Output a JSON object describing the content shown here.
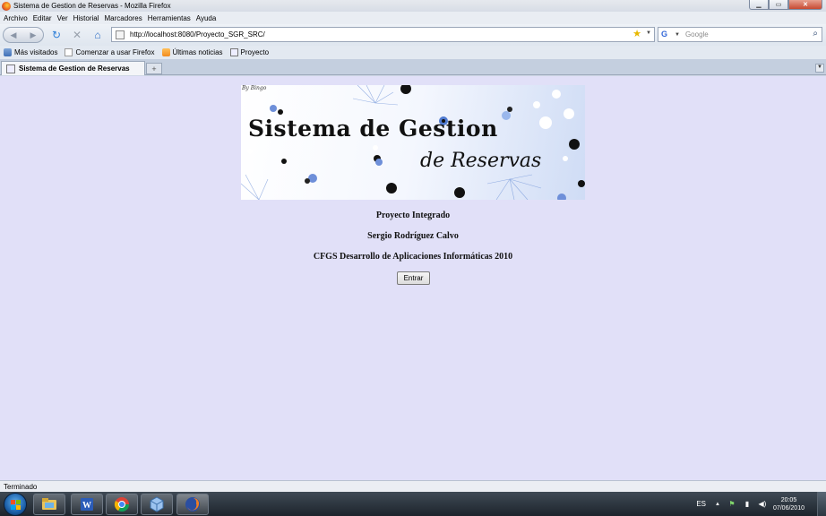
{
  "window": {
    "title": "Sistema de Gestion de Reservas - Mozilla Firefox"
  },
  "menu": {
    "items": [
      "Archivo",
      "Editar",
      "Ver",
      "Historial",
      "Marcadores",
      "Herramientas",
      "Ayuda"
    ]
  },
  "navbar": {
    "url": "http://localhost:8080/Proyecto_SGR_SRC/",
    "search_placeholder": "Google"
  },
  "bookmarks": {
    "items": [
      "Más visitados",
      "Comenzar a usar Firefox",
      "Últimas noticias",
      "Proyecto"
    ]
  },
  "tabs": {
    "active_label": "Sistema de Gestion de Reservas",
    "new_tab_label": "+"
  },
  "page": {
    "banner_signature": "By Bingo",
    "banner_title_line1": "Sistema de Gestion",
    "banner_title_line2": "de Reservas",
    "line1": "Proyecto Integrado",
    "line2": "Sergio Rodríguez Calvo",
    "line3": "CFGS Desarrollo de Aplicaciones Informáticas 2010",
    "button_label": "Entrar"
  },
  "status": {
    "text": "Terminado"
  },
  "taskbar": {
    "language": "ES",
    "time": "20:05",
    "date": "07/06/2010"
  },
  "colors": {
    "page_background": "#e1e0f8",
    "accent_blue": "#3468d8"
  }
}
